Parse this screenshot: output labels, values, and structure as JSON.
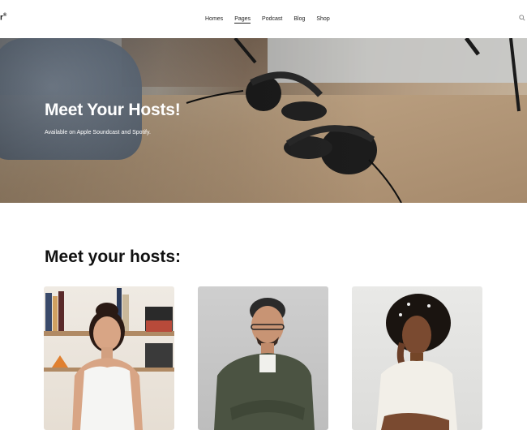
{
  "header": {
    "logo_text": "r",
    "logo_mark": "®",
    "nav": [
      {
        "label": "Homes",
        "active": false
      },
      {
        "label": "Pages",
        "active": true
      },
      {
        "label": "Podcast",
        "active": false
      },
      {
        "label": "Blog",
        "active": false
      },
      {
        "label": "Shop",
        "active": false
      }
    ],
    "search_icon": "search-icon"
  },
  "hero": {
    "title": "Meet Your Hosts!",
    "subtitle": "Available on Apple Soundcast and Spotify."
  },
  "hosts_section": {
    "title": "Meet your hosts:",
    "cards": [
      {
        "image": "host-photo-woman-bookshelf"
      },
      {
        "image": "host-photo-man-glasses"
      },
      {
        "image": "host-photo-woman-curly-hair"
      }
    ]
  },
  "colors": {
    "text": "#111111",
    "hero_text": "#ffffff",
    "background": "#ffffff"
  }
}
